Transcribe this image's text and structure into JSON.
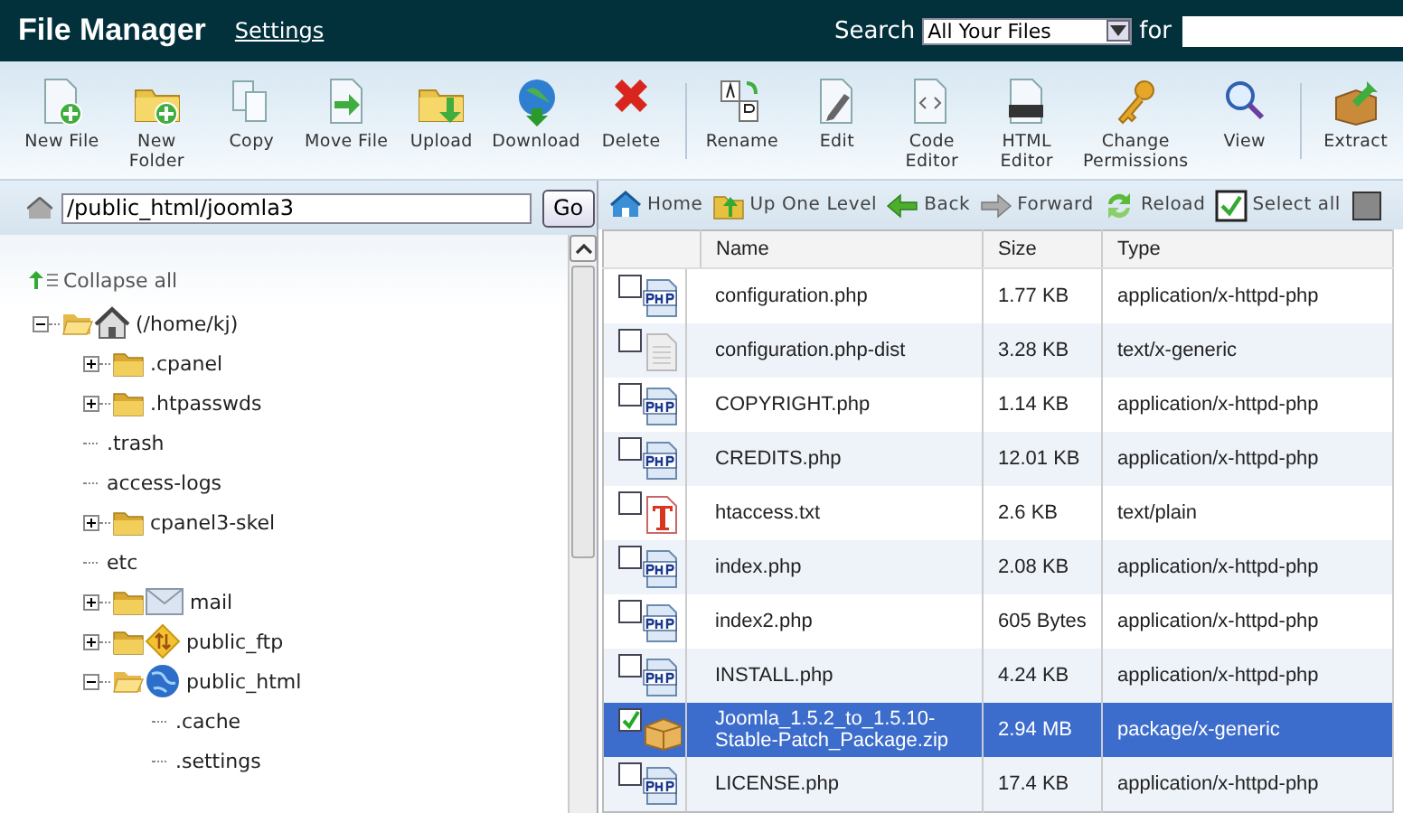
{
  "header": {
    "title": "File Manager",
    "settings_link": "Settings",
    "search_label": "Search",
    "search_scope": "All Your Files",
    "for_label": "for"
  },
  "toolbar": [
    {
      "kind": "newfile",
      "label": "New File"
    },
    {
      "kind": "newfolder",
      "label": "New Folder"
    },
    {
      "kind": "copy",
      "label": "Copy"
    },
    {
      "kind": "move",
      "label": "Move File"
    },
    {
      "kind": "upload",
      "label": "Upload"
    },
    {
      "kind": "download",
      "label": "Download"
    },
    {
      "kind": "delete",
      "label": "Delete"
    },
    {
      "kind": "separator"
    },
    {
      "kind": "rename",
      "label": "Rename"
    },
    {
      "kind": "edit",
      "label": "Edit"
    },
    {
      "kind": "code",
      "label": "Code Editor"
    },
    {
      "kind": "html",
      "label": "HTML Editor"
    },
    {
      "kind": "perms",
      "label": "Change Permissions"
    },
    {
      "kind": "view",
      "label": "View"
    },
    {
      "kind": "separator"
    },
    {
      "kind": "extract",
      "label": "Extract"
    }
  ],
  "path_bar": {
    "value": "/public_html/joomla3",
    "button": "Go"
  },
  "tree": {
    "collapse_all": "Collapse all",
    "items": [
      {
        "kind": "home",
        "label": "(/home/kj)",
        "expanded": true,
        "children": [
          {
            "kind": "folder",
            "label": ".cpanel",
            "expanded": false
          },
          {
            "kind": "folder",
            "label": ".htpasswds",
            "expanded": false
          },
          {
            "kind": "plain",
            "label": ".trash"
          },
          {
            "kind": "plain",
            "label": "access-logs"
          },
          {
            "kind": "folder",
            "label": "cpanel3-skel",
            "expanded": false
          },
          {
            "kind": "plain",
            "label": "etc"
          },
          {
            "kind": "mail",
            "label": "mail",
            "expanded": false
          },
          {
            "kind": "ftp",
            "label": "public_ftp",
            "expanded": false
          },
          {
            "kind": "web",
            "label": "public_html",
            "expanded": true,
            "children": [
              {
                "kind": "plain",
                "label": ".cache"
              },
              {
                "kind": "plain",
                "label": ".settings"
              }
            ]
          }
        ]
      }
    ]
  },
  "nav": [
    {
      "kind": "home",
      "label": "Home"
    },
    {
      "kind": "up",
      "label": "Up One Level"
    },
    {
      "kind": "back",
      "label": "Back"
    },
    {
      "kind": "forward",
      "label": "Forward"
    },
    {
      "kind": "reload",
      "label": "Reload"
    },
    {
      "kind": "selectall",
      "label": "Select all"
    }
  ],
  "table": {
    "columns": [
      "Name",
      "Size",
      "Type"
    ],
    "rows": [
      {
        "kind": "php",
        "name": "configuration.php",
        "size": "1.77 KB",
        "type": "application/x-httpd-php",
        "checked": false,
        "selected": false
      },
      {
        "kind": "generic",
        "name": "configuration.php-dist",
        "size": "3.28 KB",
        "type": "text/x-generic",
        "checked": false,
        "selected": false
      },
      {
        "kind": "php",
        "name": "COPYRIGHT.php",
        "size": "1.14 KB",
        "type": "application/x-httpd-php",
        "checked": false,
        "selected": false
      },
      {
        "kind": "php",
        "name": "CREDITS.php",
        "size": "12.01 KB",
        "type": "application/x-httpd-php",
        "checked": false,
        "selected": false
      },
      {
        "kind": "text",
        "name": "htaccess.txt",
        "size": "2.6 KB",
        "type": "text/plain",
        "checked": false,
        "selected": false
      },
      {
        "kind": "php",
        "name": "index.php",
        "size": "2.08 KB",
        "type": "application/x-httpd-php",
        "checked": false,
        "selected": false
      },
      {
        "kind": "php",
        "name": "index2.php",
        "size": "605 Bytes",
        "type": "application/x-httpd-php",
        "checked": false,
        "selected": false
      },
      {
        "kind": "php",
        "name": "INSTALL.php",
        "size": "4.24 KB",
        "type": "application/x-httpd-php",
        "checked": false,
        "selected": false
      },
      {
        "kind": "package",
        "name": "Joomla_1.5.2_to_1.5.10-Stable-Patch_Package.zip",
        "size": "2.94 MB",
        "type": "package/x-generic",
        "checked": true,
        "selected": true
      },
      {
        "kind": "php",
        "name": "LICENSE.php",
        "size": "17.4 KB",
        "type": "application/x-httpd-php",
        "checked": false,
        "selected": false
      }
    ]
  }
}
